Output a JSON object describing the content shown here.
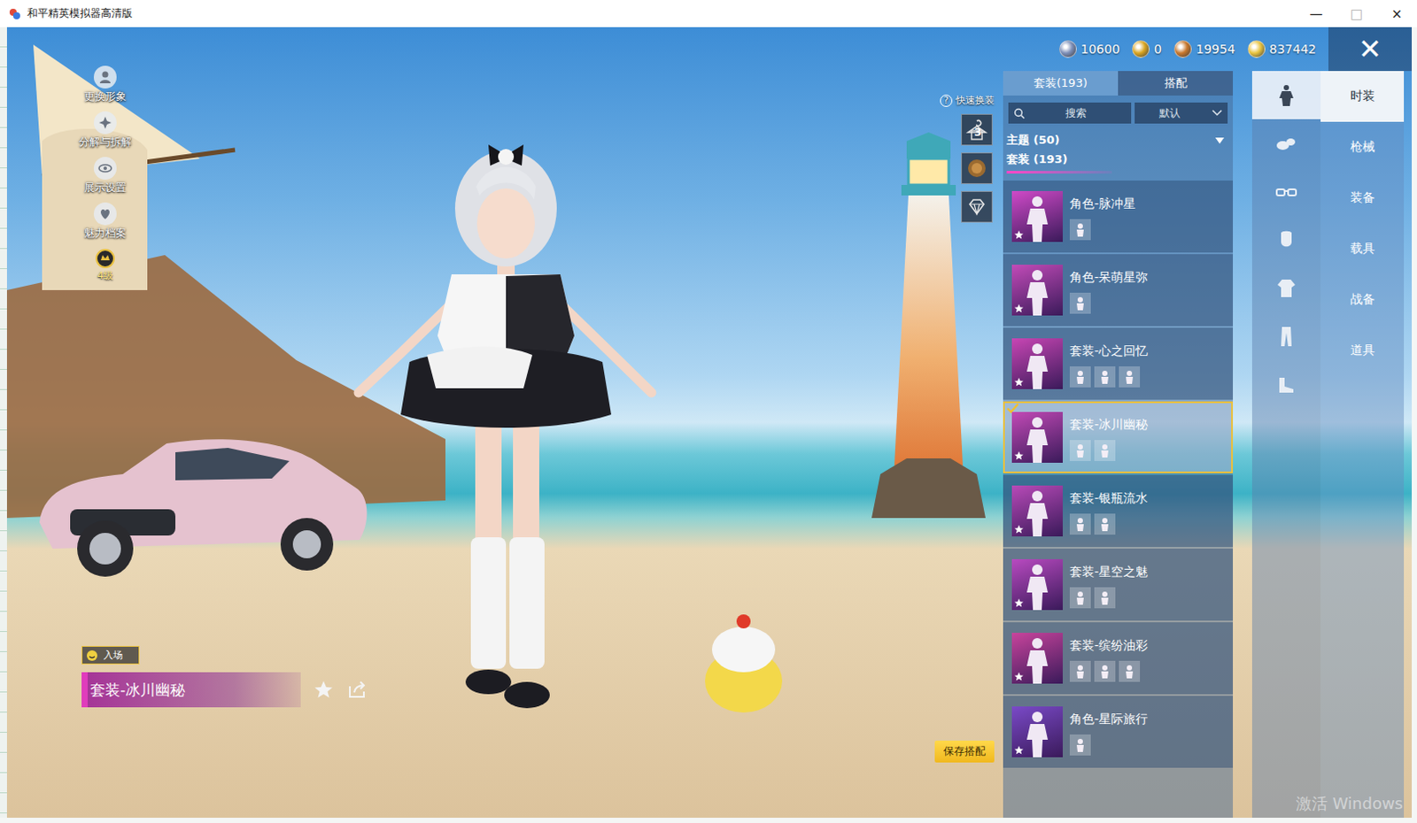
{
  "window": {
    "title": "和平精英模拟器高清版",
    "controls": [
      "—",
      "□",
      "×"
    ]
  },
  "left_menu": [
    {
      "label": "更换形象",
      "kind": "avatar"
    },
    {
      "label": "分解与拆解",
      "kind": "decompose"
    },
    {
      "label": "展示设置",
      "kind": "eye"
    },
    {
      "label": "魅力档案",
      "kind": "charm"
    }
  ],
  "level_badge": {
    "label": "4级"
  },
  "currencies": [
    {
      "amount": "10600",
      "color": "#7d8fb8"
    },
    {
      "amount": "0",
      "color": "#d9a520"
    },
    {
      "amount": "19954",
      "color": "#c8782e"
    },
    {
      "amount": "837442",
      "color": "#e8c440"
    }
  ],
  "close_button": "✕",
  "quick_change": {
    "label": "快速换装",
    "help": "?",
    "slots": [
      {
        "badge": "3",
        "kind": "hanger"
      },
      {
        "badge": "",
        "kind": "emblem"
      },
      {
        "badge": "",
        "kind": "diamond"
      }
    ]
  },
  "panel": {
    "tabs": [
      {
        "label": "套装(193)",
        "selected": true
      },
      {
        "label": "搭配",
        "selected": false
      }
    ],
    "search": {
      "placeholder": "搜索"
    },
    "sort": {
      "value": "默认"
    },
    "filters": [
      {
        "label": "主题 (50)",
        "selected": false,
        "expandable": true
      },
      {
        "label": "套装 (193)",
        "selected": true,
        "expandable": false
      }
    ],
    "items": [
      {
        "name": "角色-脉冲星",
        "parts": 1,
        "selected": false,
        "color": "#d04ac8"
      },
      {
        "name": "角色-呆萌星弥",
        "parts": 1,
        "selected": false,
        "color": "#c24bb8"
      },
      {
        "name": "套装-心之回忆",
        "parts": 3,
        "selected": false,
        "color": "#c846b4"
      },
      {
        "name": "套装-冰川幽秘",
        "parts": 2,
        "selected": true,
        "color": "#c24ab6"
      },
      {
        "name": "套装-银瓶流水",
        "parts": 2,
        "selected": false,
        "color": "#b84ab8"
      },
      {
        "name": "套装-星空之魅",
        "parts": 2,
        "selected": false,
        "color": "#b84ac0"
      },
      {
        "name": "套装-缤纷油彩",
        "parts": 3,
        "selected": false,
        "color": "#c8449c"
      },
      {
        "name": "角色-星际旅行",
        "parts": 1,
        "selected": false,
        "color": "#7a4ac8"
      }
    ]
  },
  "categories": [
    {
      "kind": "outfit",
      "selected": true
    },
    {
      "kind": "hat",
      "selected": false
    },
    {
      "kind": "glasses",
      "selected": false
    },
    {
      "kind": "mask",
      "selected": false
    },
    {
      "kind": "top",
      "selected": false
    },
    {
      "kind": "pants",
      "selected": false
    },
    {
      "kind": "shoes",
      "selected": false
    }
  ],
  "sections": [
    {
      "label": "时装",
      "selected": true
    },
    {
      "label": "枪械",
      "selected": false
    },
    {
      "label": "装备",
      "selected": false
    },
    {
      "label": "载具",
      "selected": false
    },
    {
      "label": "战备",
      "selected": false
    },
    {
      "label": "道具",
      "selected": false
    }
  ],
  "entrance": {
    "badge": "入场"
  },
  "outfit": {
    "name": "套装-冰川幽秘",
    "favorited": false
  },
  "save_button": "保存搭配",
  "watermark": "激活 Windows"
}
